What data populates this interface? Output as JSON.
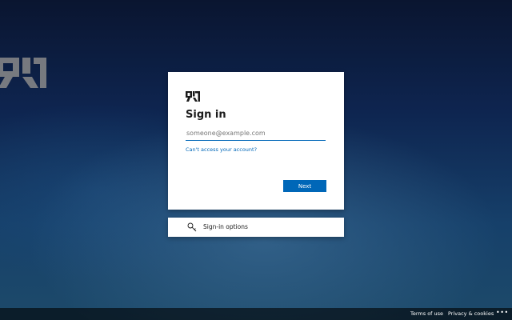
{
  "card": {
    "title": "Sign in",
    "email_placeholder": "someone@example.com",
    "email_value": "",
    "cant_access_link": "Can't access your account?",
    "next_button": "Next"
  },
  "signin_options": {
    "label": "Sign-in options",
    "icon": "key-icon"
  },
  "footer": {
    "terms": "Terms of use",
    "privacy": "Privacy & cookies",
    "more": "•••"
  },
  "colors": {
    "accent": "#0067b8",
    "card_bg": "#ffffff",
    "text": "#1b1b1b"
  }
}
